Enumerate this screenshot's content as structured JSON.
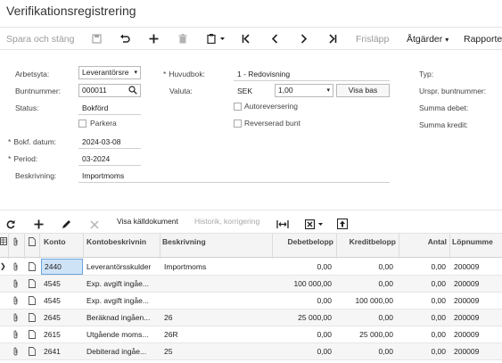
{
  "page": {
    "title": "Verifikationsregistrering"
  },
  "toolbar": {
    "save_close": "Spara och stäng",
    "release": "Frisläpp",
    "actions": "Åtgärder",
    "reports": "Rapporte",
    "icons": [
      "save-icon",
      "undo-icon",
      "plus-icon",
      "trash-icon",
      "copy-paste-icon",
      "first-icon",
      "prev-icon",
      "next-icon",
      "last-icon"
    ]
  },
  "form": {
    "workspace_label": "Arbetsyta:",
    "workspace_value": "Leverantörsre",
    "batch_label": "Buntnummer:",
    "batch_value": "000011",
    "status_label": "Status:",
    "status_value": "Bokförd",
    "hold_label": "Parkera",
    "date_label": "Bokf. datum:",
    "date_value": "2024-03-08",
    "period_label": "Period:",
    "period_value": "03-2024",
    "description_label": "Beskrivning:",
    "description_value": "Importmoms",
    "ledger_label": "Huvudbok:",
    "ledger_value": "1 - Redovisning",
    "currency_label": "Valuta:",
    "currency_code": "SEK",
    "currency_rate": "1,00",
    "view_base": "Visa bas",
    "auto_reverse": "Autoreversering",
    "reverse_batch": "Reverserad bunt",
    "type_label": "Typ:",
    "orig_batch_label": "Urspr. buntnummer:",
    "sum_debit_label": "Summa debet:",
    "sum_credit_label": "Summa kredit:"
  },
  "grid_toolbar": {
    "show_source": "Visa källdokument",
    "history": "Historik, korrigering"
  },
  "grid": {
    "headers": {
      "account": "Konto",
      "account_desc": "Kontobeskrivnin",
      "description": "Beskrivning",
      "debit": "Debetbelopp",
      "credit": "Kreditbelopp",
      "qty": "Antal",
      "line_no": "Löpnumme"
    },
    "rows": [
      {
        "account": "2440",
        "account_desc": "Leverantörsskulder",
        "description": "Importmoms",
        "debit": "0,00",
        "credit": "0,00",
        "qty": "0,00",
        "line_no": "200009"
      },
      {
        "account": "4545",
        "account_desc": "Exp. avgift ingåe...",
        "description": "",
        "debit": "100 000,00",
        "credit": "0,00",
        "qty": "0,00",
        "line_no": "200009"
      },
      {
        "account": "4545",
        "account_desc": "Exp. avgift ingåe...",
        "description": "",
        "debit": "0,00",
        "credit": "100 000,00",
        "qty": "0,00",
        "line_no": "200009"
      },
      {
        "account": "2645",
        "account_desc": "Beräknad ingåen...",
        "description": "26",
        "debit": "25 000,00",
        "credit": "0,00",
        "qty": "0,00",
        "line_no": "200009"
      },
      {
        "account": "2615",
        "account_desc": "Utgående moms...",
        "description": "26R",
        "debit": "0,00",
        "credit": "25 000,00",
        "qty": "0,00",
        "line_no": "200009"
      },
      {
        "account": "2641",
        "account_desc": "Debiterad ingåe...",
        "description": "25",
        "debit": "0,00",
        "credit": "0,00",
        "qty": "0,00",
        "line_no": "200009"
      }
    ]
  }
}
